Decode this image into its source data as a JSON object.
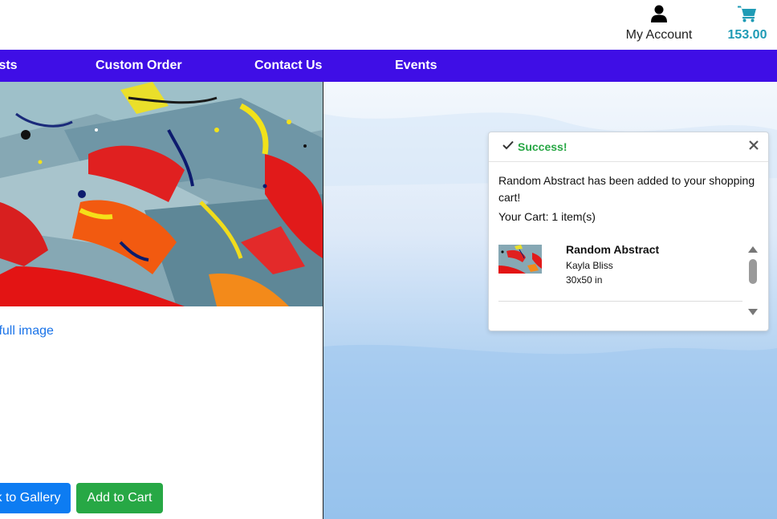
{
  "header": {
    "account_label": "My Account",
    "cart_total": "153.00",
    "cart_color": "#1f9bb5"
  },
  "nav": {
    "items": [
      {
        "label": "ists"
      },
      {
        "label": "Custom Order"
      },
      {
        "label": "Contact Us"
      },
      {
        "label": "Events"
      }
    ],
    "background": "#3f0ee6"
  },
  "main": {
    "view_full_image_label": "v full image",
    "back_button_label": "k to Gallery",
    "add_to_cart_label": "Add to Cart"
  },
  "toast": {
    "title": "Success!",
    "message": "Random Abstract has been added to your shopping cart!",
    "cart_summary": "Your Cart: 1 item(s)",
    "items": [
      {
        "name": "Random Abstract",
        "artist": "Kayla Bliss",
        "size": "30x50 in"
      }
    ],
    "title_color": "#28a745"
  }
}
